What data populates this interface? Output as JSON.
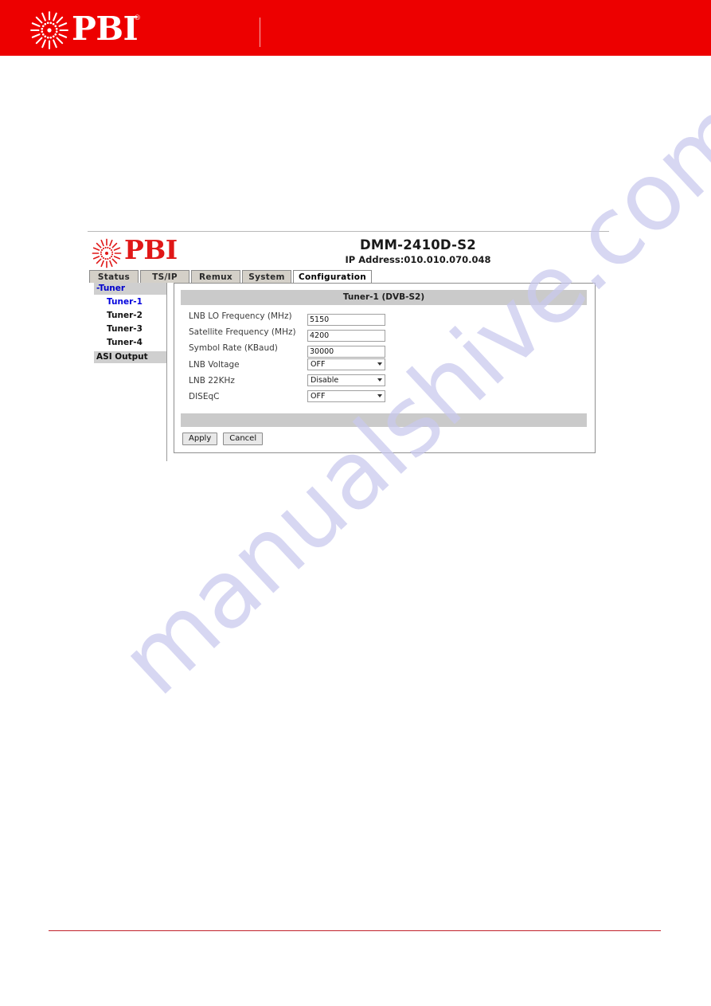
{
  "banner": {
    "brand": "PBI",
    "registered_mark": "®",
    "background_color": "#ed0000",
    "starburst_icon": "starburst-icon"
  },
  "device_ui": {
    "logo": {
      "brand": "PBI",
      "color": "#e01717",
      "starburst_icon": "starburst-icon"
    },
    "title": "DMM-2410D-S2",
    "ip_address": "IP Address:010.010.070.048",
    "tabs": [
      {
        "label": "Status",
        "active": false
      },
      {
        "label": "TS/IP",
        "active": false
      },
      {
        "label": "Remux",
        "active": false
      },
      {
        "label": "System",
        "active": false
      },
      {
        "label": "Configuration",
        "active": true
      }
    ],
    "sidebar": {
      "groups": [
        {
          "label": "-Tuner",
          "selected": true,
          "items": [
            {
              "label": "Tuner-1",
              "selected": true
            },
            {
              "label": "Tuner-2",
              "selected": false
            },
            {
              "label": "Tuner-3",
              "selected": false
            },
            {
              "label": "Tuner-4",
              "selected": false
            }
          ]
        },
        {
          "label": "ASI Output",
          "selected": false,
          "items": []
        }
      ]
    },
    "panel": {
      "header": "Tuner-1 (DVB-S2)",
      "fields": [
        {
          "label": "LNB LO Frequency (MHz)",
          "type": "text",
          "value": "5150"
        },
        {
          "label": "Satellite Frequency (MHz)",
          "type": "text",
          "value": "4200"
        },
        {
          "label": "Symbol Rate (KBaud)",
          "type": "text",
          "value": "30000"
        },
        {
          "label": "LNB Voltage",
          "type": "select",
          "value": "OFF"
        },
        {
          "label": "LNB 22KHz",
          "type": "select",
          "value": "Disable"
        },
        {
          "label": "DISEqC",
          "type": "select",
          "value": "OFF"
        }
      ],
      "buttons": [
        {
          "label": "Apply"
        },
        {
          "label": "Cancel"
        }
      ]
    }
  },
  "watermark": {
    "text": "manualshive.com",
    "color": "#c9c9ee"
  }
}
